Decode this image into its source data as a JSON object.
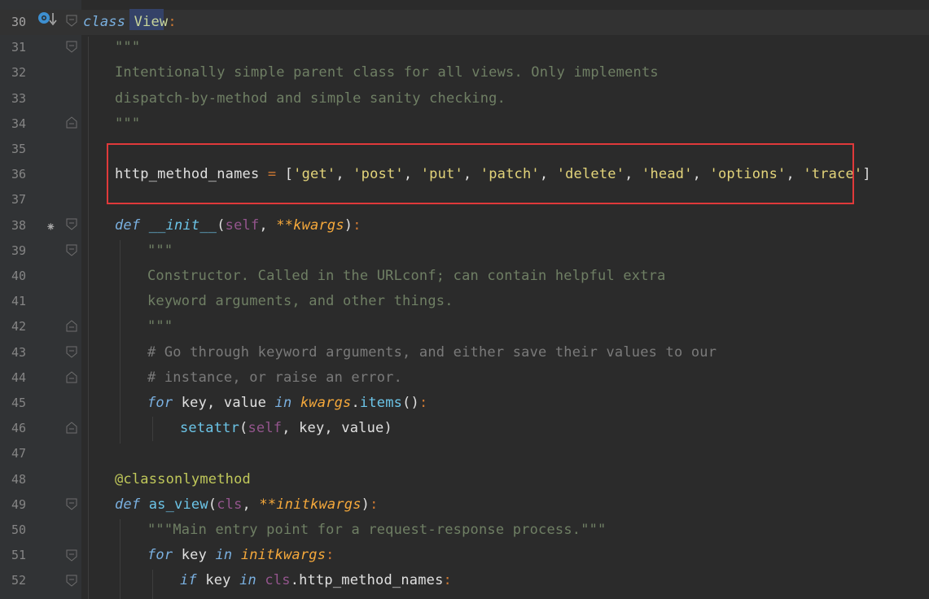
{
  "editor": {
    "language": "python",
    "lines": [
      {
        "num": "30"
      },
      {
        "num": "31"
      },
      {
        "num": "32"
      },
      {
        "num": "33"
      },
      {
        "num": "34"
      },
      {
        "num": "35"
      },
      {
        "num": "36"
      },
      {
        "num": "37"
      },
      {
        "num": "38"
      },
      {
        "num": "39"
      },
      {
        "num": "40"
      },
      {
        "num": "41"
      },
      {
        "num": "42"
      },
      {
        "num": "43"
      },
      {
        "num": "44"
      },
      {
        "num": "45"
      },
      {
        "num": "46"
      },
      {
        "num": "47"
      },
      {
        "num": "48"
      },
      {
        "num": "49"
      },
      {
        "num": "50"
      },
      {
        "num": "51"
      },
      {
        "num": "52"
      }
    ],
    "code": {
      "l30": {
        "kw": "class",
        "name": "View",
        "colon": ":"
      },
      "l31": {
        "doc": "\"\"\""
      },
      "l32": {
        "doc": "Intentionally simple parent class for all views. Only implements"
      },
      "l33": {
        "doc": "dispatch-by-method and simple sanity checking."
      },
      "l34": {
        "doc": "\"\"\""
      },
      "l36": {
        "var": "http_method_names",
        "eq": "=",
        "open": "[",
        "items": [
          "'get'",
          "'post'",
          "'put'",
          "'patch'",
          "'delete'",
          "'head'",
          "'options'",
          "'trace'"
        ],
        "sep": ",",
        "close": "]"
      },
      "l38": {
        "kw": "def",
        "name": "__init__",
        "open": "(",
        "self": "self",
        "comma": ",",
        "kwargs": "**kwargs",
        "close": ")",
        "colon": ":"
      },
      "l39": {
        "doc": "\"\"\""
      },
      "l40": {
        "doc": "Constructor. Called in the URLconf; can contain helpful extra"
      },
      "l41": {
        "doc": "keyword arguments, and other things."
      },
      "l42": {
        "doc": "\"\"\""
      },
      "l43": {
        "cmt": "# Go through keyword arguments, and either save their values to our"
      },
      "l44": {
        "cmt": "# instance, or raise an error."
      },
      "l45": {
        "kw_for": "for",
        "vars": "key, value",
        "kw_in": "in",
        "iter": "kwargs",
        "dot": ".",
        "method": "items",
        "parens": "()",
        "colon": ":"
      },
      "l46": {
        "fn": "setattr",
        "open": "(",
        "self": "self",
        "args": ", key, value",
        "close": ")"
      },
      "l48": {
        "decorator": "@classonlymethod"
      },
      "l49": {
        "kw": "def",
        "name": "as_view",
        "open": "(",
        "cls": "cls",
        "comma": ",",
        "kwargs": "**initkwargs",
        "close": ")",
        "colon": ":"
      },
      "l50": {
        "doc_open": "\"\"\"",
        "doc": "Main entry point for a request-response process.",
        "doc_close": "\"\"\""
      },
      "l51": {
        "kw_for": "for",
        "var": "key",
        "kw_in": "in",
        "iter": "initkwargs",
        "colon": ":"
      },
      "l52": {
        "kw_if": "if",
        "var": "key",
        "kw_in": "in",
        "cls": "cls",
        "dot": ".",
        "attr": "http_method_names",
        "colon": ":"
      }
    },
    "gutter_icons": {
      "override": "override-down-arrow-icon",
      "implemented": "asterisk-icon",
      "implemented_glyph": "⁕"
    },
    "colors": {
      "background": "#2b2b2b",
      "gutter": "#313335",
      "keyword": "#7ab0e0",
      "string": "#e3d47a",
      "docstring": "#6f7f64",
      "comment": "#7a7a7a",
      "highlight_box": "#e0393a"
    }
  }
}
